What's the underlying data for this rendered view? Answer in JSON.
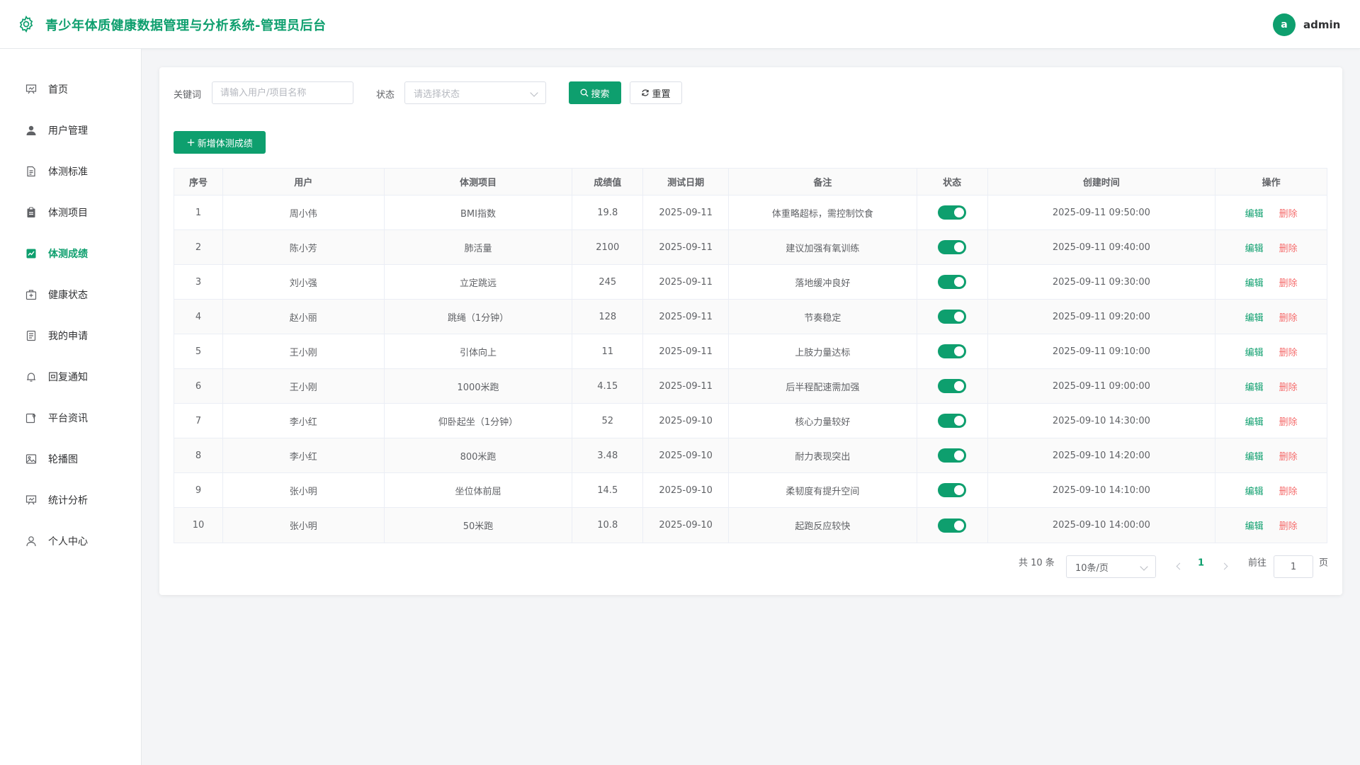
{
  "header": {
    "title": "青少年体质健康数据管理与分析系统-管理员后台",
    "avatar_letter": "a",
    "username": "admin"
  },
  "sidebar": {
    "items": [
      {
        "label": "首页",
        "icon": "dashboard-icon"
      },
      {
        "label": "用户管理",
        "icon": "user-icon"
      },
      {
        "label": "体测标准",
        "icon": "document-icon"
      },
      {
        "label": "体测项目",
        "icon": "clipboard-icon"
      },
      {
        "label": "体测成绩",
        "icon": "chart-check-icon"
      },
      {
        "label": "健康状态",
        "icon": "medical-kit-icon"
      },
      {
        "label": "我的申请",
        "icon": "list-document-icon"
      },
      {
        "label": "回复通知",
        "icon": "bell-icon"
      },
      {
        "label": "平台资讯",
        "icon": "news-icon"
      },
      {
        "label": "轮播图",
        "icon": "picture-icon"
      },
      {
        "label": "统计分析",
        "icon": "presentation-icon"
      },
      {
        "label": "个人中心",
        "icon": "person-icon"
      }
    ],
    "active": "体测成绩"
  },
  "filters": {
    "keyword_label": "关键词",
    "keyword_placeholder": "请输入用户/项目名称",
    "status_label": "状态",
    "status_placeholder": "请选择状态",
    "search_label": "搜索",
    "reset_label": "重置"
  },
  "add_button_label": "新增体测成绩",
  "table": {
    "columns": [
      "序号",
      "用户",
      "体测项目",
      "成绩值",
      "测试日期",
      "备注",
      "状态",
      "创建时间",
      "操作"
    ],
    "rows": [
      {
        "idx": "1",
        "user": "周小伟",
        "item": "BMI指数",
        "score": "19.8",
        "date": "2025-09-11",
        "note": "体重略超标，需控制饮食",
        "enabled": true,
        "created": "2025-09-11 09:50:00"
      },
      {
        "idx": "2",
        "user": "陈小芳",
        "item": "肺活量",
        "score": "2100",
        "date": "2025-09-11",
        "note": "建议加强有氧训练",
        "enabled": true,
        "created": "2025-09-11 09:40:00"
      },
      {
        "idx": "3",
        "user": "刘小强",
        "item": "立定跳远",
        "score": "245",
        "date": "2025-09-11",
        "note": "落地缓冲良好",
        "enabled": true,
        "created": "2025-09-11 09:30:00"
      },
      {
        "idx": "4",
        "user": "赵小丽",
        "item": "跳绳（1分钟）",
        "score": "128",
        "date": "2025-09-11",
        "note": "节奏稳定",
        "enabled": true,
        "created": "2025-09-11 09:20:00"
      },
      {
        "idx": "5",
        "user": "王小刚",
        "item": "引体向上",
        "score": "11",
        "date": "2025-09-11",
        "note": "上肢力量达标",
        "enabled": true,
        "created": "2025-09-11 09:10:00"
      },
      {
        "idx": "6",
        "user": "王小刚",
        "item": "1000米跑",
        "score": "4.15",
        "date": "2025-09-11",
        "note": "后半程配速需加强",
        "enabled": true,
        "created": "2025-09-11 09:00:00"
      },
      {
        "idx": "7",
        "user": "李小红",
        "item": "仰卧起坐（1分钟）",
        "score": "52",
        "date": "2025-09-10",
        "note": "核心力量较好",
        "enabled": true,
        "created": "2025-09-10 14:30:00"
      },
      {
        "idx": "8",
        "user": "李小红",
        "item": "800米跑",
        "score": "3.48",
        "date": "2025-09-10",
        "note": "耐力表现突出",
        "enabled": true,
        "created": "2025-09-10 14:20:00"
      },
      {
        "idx": "9",
        "user": "张小明",
        "item": "坐位体前屈",
        "score": "14.5",
        "date": "2025-09-10",
        "note": "柔韧度有提升空间",
        "enabled": true,
        "created": "2025-09-10 14:10:00"
      },
      {
        "idx": "10",
        "user": "张小明",
        "item": "50米跑",
        "score": "10.8",
        "date": "2025-09-10",
        "note": "起跑反应较快",
        "enabled": true,
        "created": "2025-09-10 14:00:00"
      }
    ],
    "edit_label": "编辑",
    "delete_label": "删除"
  },
  "pagination": {
    "total_text": "共 10 条",
    "page_size": "10条/页",
    "current_page": "1",
    "goto_label": "前往",
    "goto_value": "1",
    "page_suffix": "页"
  },
  "colors": {
    "accent": "#0e9f6e",
    "danger": "#f56c6c"
  }
}
